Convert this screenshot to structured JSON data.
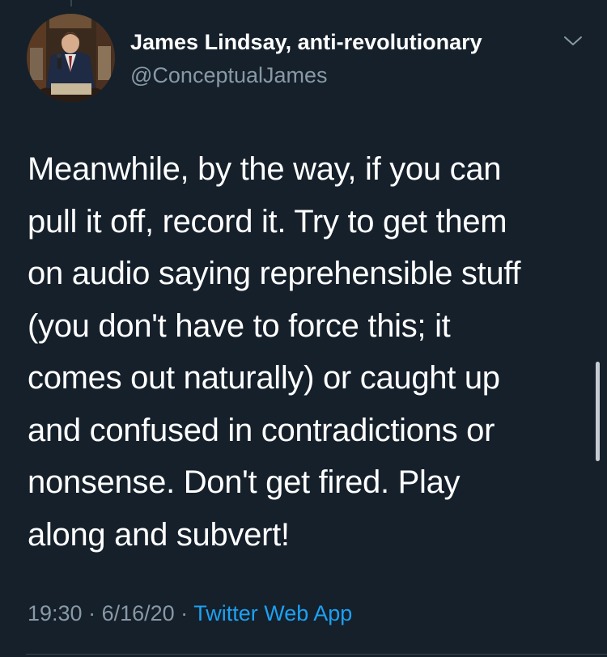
{
  "theme": {
    "background": "#15202b",
    "primary_text": "#ffffff",
    "secondary_text": "#8899a6",
    "link": "#1da1f2",
    "divider": "#38444d"
  },
  "tweet": {
    "author": {
      "display_name": "James Lindsay, anti-revolutionary",
      "handle": "@ConceptualJames",
      "avatar_icon": "profile-photo"
    },
    "menu_icon": "chevron-down-icon",
    "text": "Meanwhile, by the way, if you can\npull it off, record it. Try to get them\non audio saying reprehensible stuff\n(you don't have to force this; it\ncomes out naturally) or caught up\nand confused in contradictions or\nnonsense. Don't get fired. Play\nalong and subvert!",
    "time": "19:30",
    "separator_1": " · ",
    "date": "6/16/20",
    "separator_2": " · ",
    "source": "Twitter Web App"
  }
}
